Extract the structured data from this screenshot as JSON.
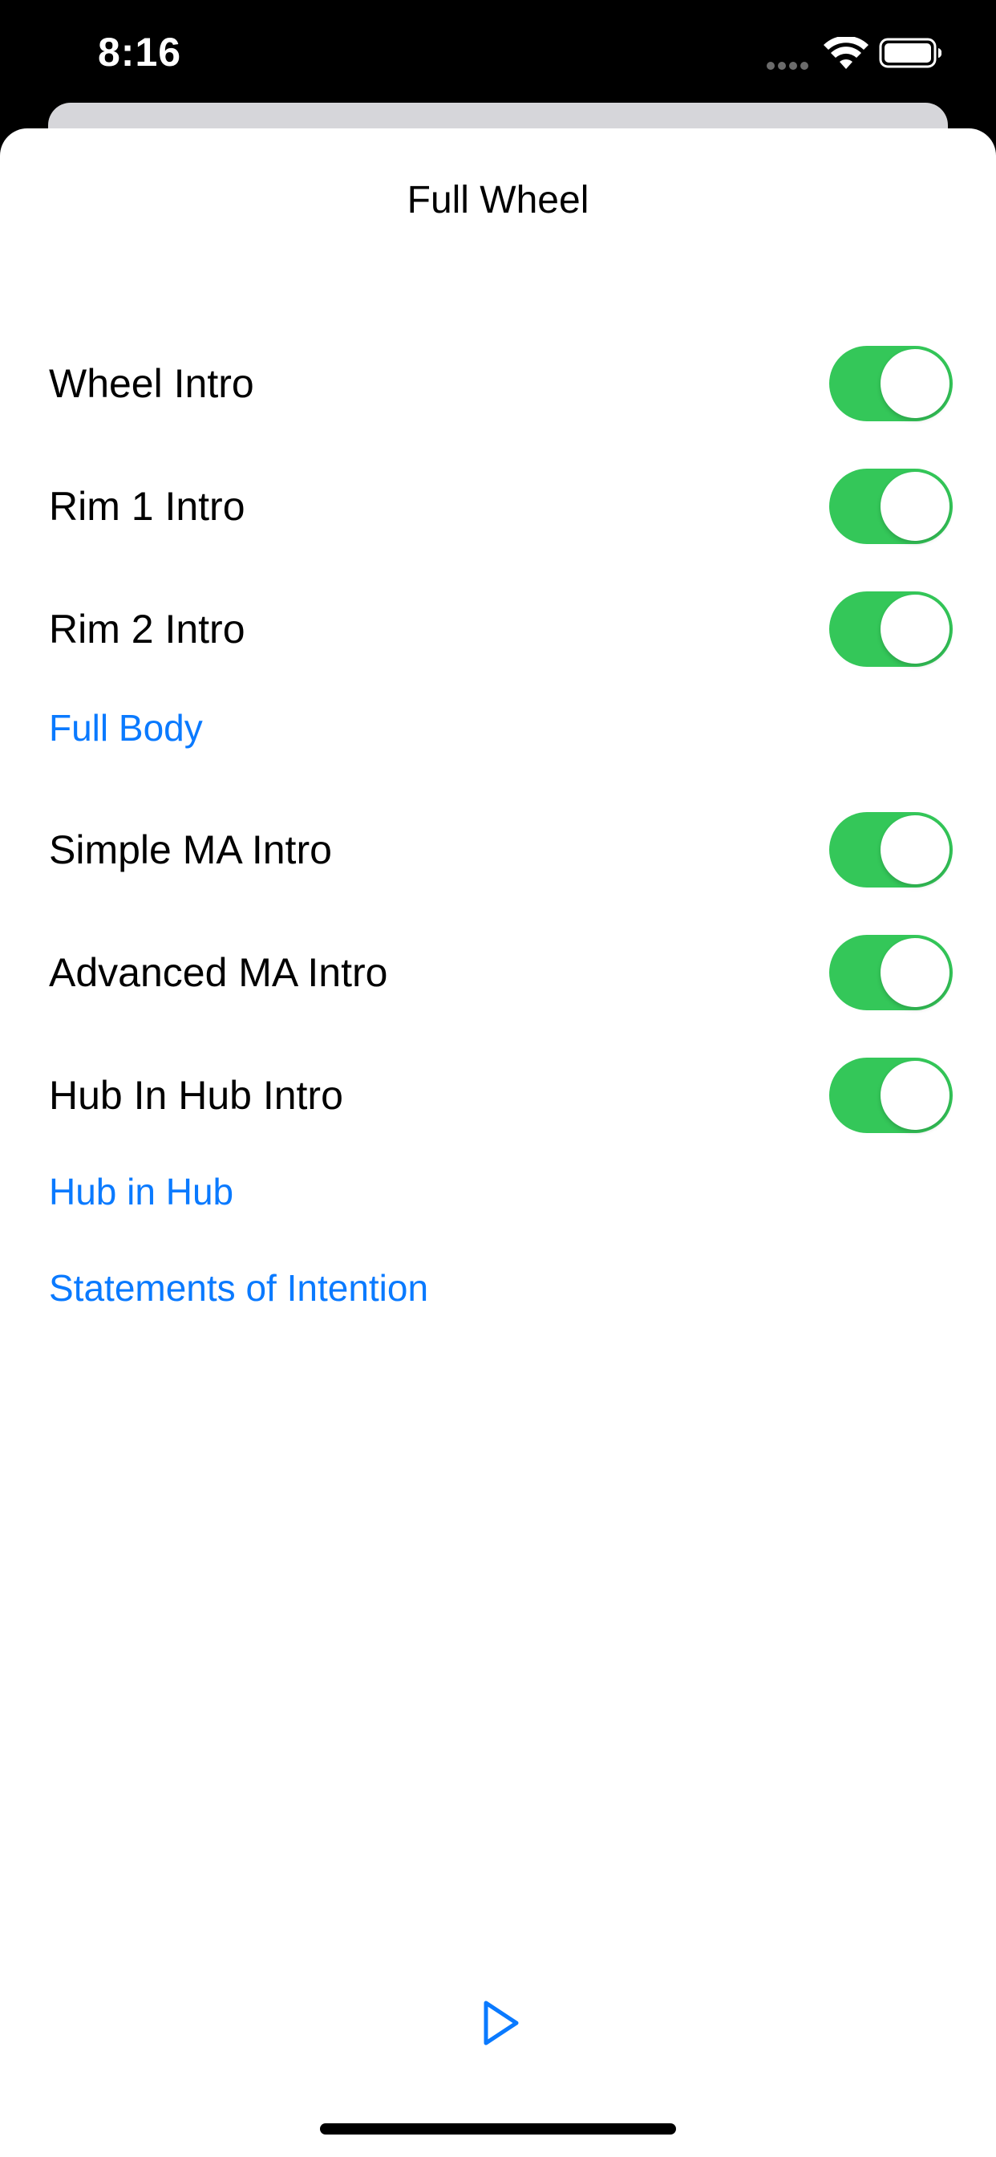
{
  "status_bar": {
    "time": "8:16"
  },
  "sheet": {
    "title": "Full Wheel"
  },
  "sections": [
    {
      "toggles": [
        {
          "label": "Wheel Intro",
          "on": true
        },
        {
          "label": "Rim 1 Intro",
          "on": true
        },
        {
          "label": "Rim 2 Intro",
          "on": true
        }
      ],
      "link": "Full Body"
    },
    {
      "toggles": [
        {
          "label": "Simple MA Intro",
          "on": true
        },
        {
          "label": "Advanced MA Intro",
          "on": true
        },
        {
          "label": "Hub In Hub Intro",
          "on": true
        }
      ],
      "link": "Hub in Hub"
    }
  ],
  "extra_link": "Statements of Intention",
  "icons": {
    "play": "play-icon",
    "wifi": "wifi-icon",
    "battery": "battery-icon",
    "signal": "signal-dots-icon"
  },
  "colors": {
    "toggle_on": "#34c759",
    "link": "#0a7aff",
    "status_bar": "#000000"
  }
}
